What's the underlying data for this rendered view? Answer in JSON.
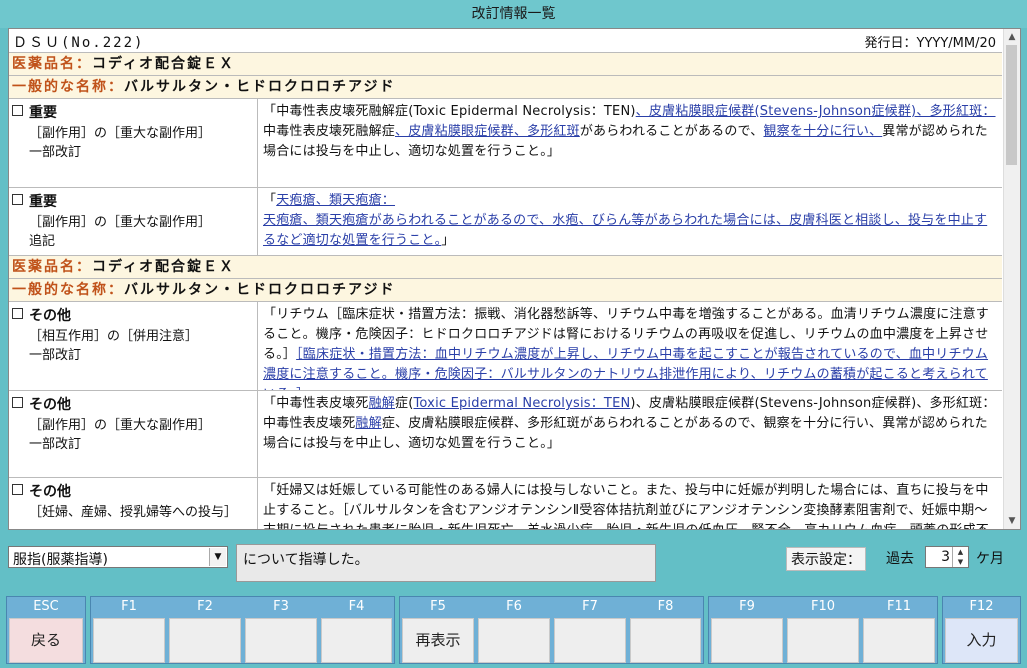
{
  "window": {
    "title": "改訂情報一覧"
  },
  "document": {
    "id": "ＤＳＵ(No.222)",
    "issue_date": "発行日：YYYY/MM/20"
  },
  "drug_label": "医薬品名：",
  "generic_label": "一般的な名称：",
  "groups": [
    {
      "drug_name": "コディオ配合錠ＥＸ",
      "generic_name": "バルサルタン・ヒドロクロロチアジド",
      "rows": [
        {
          "category": "重要",
          "section": "［副作用］の［重大な副作用］",
          "type": "一部改訂",
          "text": [
            {
              "t": "「中毒性表皮壊死融解症(Toxic Epidermal Necrolysis：TEN)"
            },
            {
              "t": "、皮膚粘膜眼症候群(Stevens-Johnson症候群)、多形紅斑：",
              "link": true
            },
            {
              "t": "中毒性表皮壊死融解症",
              "br": true
            },
            {
              "t": "、皮膚粘膜眼症候群、多形紅斑",
              "link": true
            },
            {
              "t": "があらわれることがあるので、"
            },
            {
              "t": "観察を十分に行い、",
              "link": true
            },
            {
              "t": "異常が認められた場合には投与を中止し、適切な処置を行うこと。」"
            }
          ]
        },
        {
          "category": "重要",
          "section": "［副作用］の［重大な副作用］",
          "type": "追記",
          "text": [
            {
              "t": "「"
            },
            {
              "t": "天疱瘡、類天疱瘡：",
              "link": true
            },
            {
              "t": "天疱瘡、類天疱瘡があらわれることがあるので、水疱、びらん等があらわれた場合には、皮膚科医と相談し、投与を中止するなど適切な処置を行うこと。",
              "link": true,
              "br": true
            },
            {
              "t": "」"
            }
          ]
        }
      ]
    },
    {
      "drug_name": "コディオ配合錠ＥＸ",
      "generic_name": "バルサルタン・ヒドロクロロチアジド",
      "rows": [
        {
          "category": "その他",
          "section": "［相互作用］の［併用注意］",
          "type": "一部改訂",
          "text": [
            {
              "t": "「リチウム［臨床症状・措置方法：振戦、消化器愁訴等、リチウム中毒を増強することがある。血清リチウム濃度に注意すること。機序・危険因子：ヒドロクロロチアジドは腎におけるリチウムの再吸収を促進し、リチウムの血中濃度を上昇させる。］"
            },
            {
              "t": "［臨床症状・措置方法：血中リチウム濃度が上昇し、リチウム中毒を起こすことが報告されているので、血中リチウム濃度に注意すること。機序・危険因子：バルサルタンのナトリウム排泄作用により、リチウムの蓄積が起こると考えられている。］",
              "link": true
            },
            {
              "t": "」"
            }
          ]
        },
        {
          "category": "その他",
          "section": "［副作用］の［重大な副作用］",
          "type": "一部改訂",
          "text": [
            {
              "t": "「中毒性表皮壊死"
            },
            {
              "t": "融解",
              "link": true
            },
            {
              "t": "症("
            },
            {
              "t": "Toxic Epidermal Necrolysis：TEN",
              "link": true
            },
            {
              "t": ")、皮膚粘膜眼症候群(Stevens-Johnson症候群)、多形紅斑："
            },
            {
              "t": "中毒性表皮壊死",
              "br": true
            },
            {
              "t": "融解",
              "link": true
            },
            {
              "t": "症、皮膚粘膜眼症候群、多形紅斑があらわれることがあるので、観察を十分に行い、異常が認められた場合には投与を中止し、適切な処置を行うこと。」"
            }
          ]
        },
        {
          "category": "その他",
          "section": "［妊婦、産婦、授乳婦等への投与］",
          "type": "",
          "text": [
            {
              "t": "「妊婦又は妊娠している可能性のある婦人には投与しないこと。また、投与中に妊娠が判明した場合には、直ちに投与を中止すること。［バルサルタンを含むアンジオテンシンⅡ受容体拮抗剤並びにアンジオテンシン変換酵素阻害剤で、妊娠中期～末期に投与された患者に胎児・新生児死亡、羊水過少症、胎児・新生児の低血圧、腎不全、高カリウム血症、頭蓋の形成不全"
            }
          ]
        }
      ]
    }
  ],
  "footer": {
    "guidance_select": "服指(服薬指導)",
    "memo": "について指導した。",
    "display_setting_label": "表示設定：",
    "past_label": "過去",
    "months_value": "3",
    "months_unit": "ケ月"
  },
  "fkeys": [
    {
      "key": "ESC",
      "label": "戻る"
    },
    {
      "key": "F1",
      "label": ""
    },
    {
      "key": "F2",
      "label": ""
    },
    {
      "key": "F3",
      "label": ""
    },
    {
      "key": "F4",
      "label": ""
    },
    {
      "key": "F5",
      "label": "再表示"
    },
    {
      "key": "F6",
      "label": ""
    },
    {
      "key": "F7",
      "label": ""
    },
    {
      "key": "F8",
      "label": ""
    },
    {
      "key": "F9",
      "label": ""
    },
    {
      "key": "F10",
      "label": ""
    },
    {
      "key": "F11",
      "label": ""
    },
    {
      "key": "F12",
      "label": "入力"
    }
  ]
}
